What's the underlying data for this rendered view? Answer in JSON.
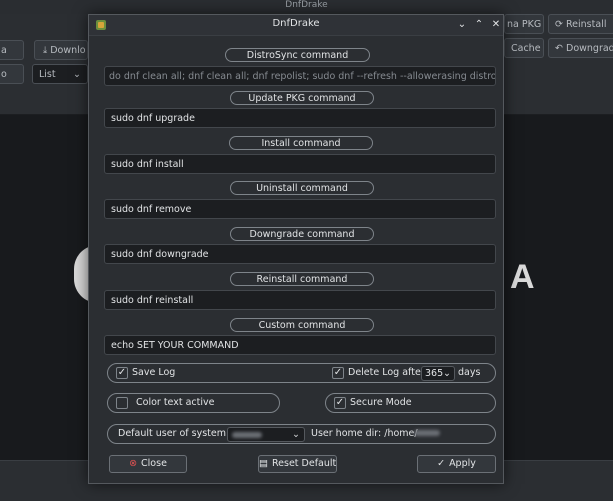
{
  "background": {
    "title": "DnfDrake",
    "toolbar_buttons": [
      "a",
      "Downlo",
      "na PKG",
      "Reinstall",
      "Cache",
      "Downgrad",
      "o",
      "List"
    ],
    "logo_text": "A"
  },
  "dialog": {
    "title": "DnfDrake",
    "title_controls": {
      "minimize": "⌄",
      "maximize": "⌃",
      "close": "✕"
    },
    "distrosync": {
      "label": "DistroSync command",
      "placeholder": "do dnf clean all; dnf clean all; dnf repolist; sudo dnf --refresh --allowerasing distro-sync"
    },
    "update": {
      "label": "Update PKG command",
      "value": "sudo dnf upgrade"
    },
    "install": {
      "label": "Install command",
      "value": "sudo dnf install"
    },
    "uninstall": {
      "label": "Uninstall command",
      "value": "sudo dnf remove"
    },
    "downgrade": {
      "label": "Downgrade command",
      "value": "sudo dnf downgrade"
    },
    "reinstall": {
      "label": "Reinstall command",
      "value": "sudo dnf reinstall"
    },
    "custom": {
      "label": "Custom command",
      "value": "echo SET YOUR COMMAND"
    },
    "options": {
      "save_log": {
        "label": "Save Log",
        "checked": true
      },
      "delete_log": {
        "label": "Delete Log after",
        "checked": true,
        "days_value": "365",
        "days_unit": "days"
      },
      "color_text": {
        "label": "Color text active",
        "checked": false
      },
      "secure_mode": {
        "label": "Secure Mode",
        "checked": true
      }
    },
    "user": {
      "default_user_label": "Default user of system:",
      "home_dir_label": "User home dir: /home/"
    },
    "buttons": {
      "close": "Close",
      "reset": "Reset Default",
      "apply": "Apply"
    },
    "colors": {
      "close_icon": "#e05252",
      "accent_check": "#e2e4e6"
    }
  }
}
